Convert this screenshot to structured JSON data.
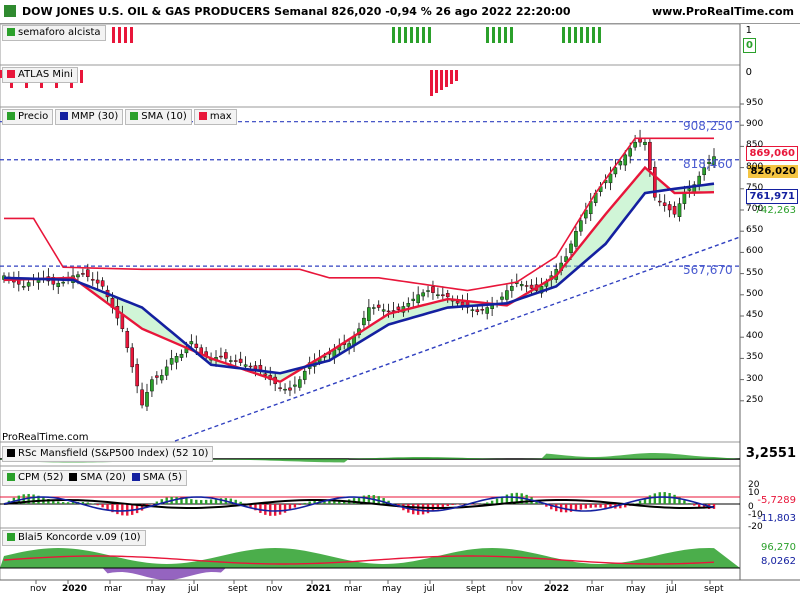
{
  "header": {
    "title": "DOW JONES U.S. OIL & GAS PRODUCERS Semanal 826,020 -0,94 % 26 ago 2022 22:20:00",
    "site": "www.ProRealTime.com"
  },
  "watermark": "ProRealTime.com",
  "panels": {
    "semaforo": {
      "label": "semaforo alcista",
      "value_top": "1",
      "value_box": "0"
    },
    "atlas": {
      "label": "ATLAS Mini",
      "value": "0"
    },
    "main": {
      "legend": [
        "Precio",
        "MMP (30)",
        "SMA (10)",
        "max"
      ],
      "right_labels": {
        "max": "869,060",
        "price": "826,020",
        "mmp": "761,971",
        "sma": "742,263"
      },
      "hline_labels": [
        "908,250",
        "818,460",
        "567,670"
      ],
      "y_ticks": [
        "950",
        "900",
        "850",
        "800",
        "750",
        "700",
        "650",
        "600",
        "550",
        "500",
        "450",
        "400",
        "350",
        "300",
        "250"
      ]
    },
    "rsc": {
      "label": "RSc Mansfield (S&P500 Index) (52 10)",
      "value": "3,2551"
    },
    "cpm": {
      "label_cpm": "CPM (52)",
      "label_sma20": "SMA (20)",
      "label_sma5": "SMA (5)",
      "ticks": [
        "20",
        "10",
        "0",
        "-10",
        "-20"
      ],
      "v1": "-5,7289",
      "v2": "-11,803"
    },
    "blai5": {
      "label": "Blai5 Koncorde v.09 (10)",
      "v1": "96,270",
      "v2": "8,0262"
    }
  },
  "x_axis": [
    "nov",
    "2020",
    "mar",
    "may",
    "jul",
    "sept",
    "nov",
    "2021",
    "mar",
    "may",
    "jul",
    "sept",
    "nov",
    "2022",
    "mar",
    "may",
    "jul",
    "sept"
  ],
  "colors": {
    "green": "#2ba02b",
    "red": "#e8163a",
    "blue": "#1420a0",
    "dash": "#3040c0",
    "cloud": "#96e8a6",
    "pink": "#f3b6c4"
  },
  "chart_data": {
    "type": "candlestick",
    "title": "DOW JONES U.S. OIL & GAS PRODUCERS Semanal 826,020 -0,94 % 26 ago 2022 22:20:00",
    "xlabel": "",
    "ylabel": "",
    "x_range": [
      "2019-10",
      "2022-09"
    ],
    "ylim": [
      200,
      950
    ],
    "last_close": 826.02,
    "change_pct": -0.94,
    "horizontal_levels": [
      908.25,
      818.46,
      567.67
    ],
    "series": [
      {
        "name": "Precio",
        "points": [
          [
            0,
            545
          ],
          [
            2,
            530
          ],
          [
            4,
            520
          ],
          [
            6,
            538
          ],
          [
            8,
            540
          ],
          [
            10,
            525
          ],
          [
            12,
            530
          ],
          [
            14,
            545
          ],
          [
            16,
            550
          ],
          [
            18,
            535
          ],
          [
            20,
            520
          ],
          [
            22,
            470
          ],
          [
            24,
            420
          ],
          [
            26,
            330
          ],
          [
            28,
            240
          ],
          [
            30,
            300
          ],
          [
            32,
            310
          ],
          [
            34,
            350
          ],
          [
            36,
            360
          ],
          [
            38,
            390
          ],
          [
            40,
            360
          ],
          [
            42,
            350
          ],
          [
            44,
            355
          ],
          [
            46,
            345
          ],
          [
            48,
            340
          ],
          [
            50,
            330
          ],
          [
            52,
            320
          ],
          [
            54,
            300
          ],
          [
            56,
            280
          ],
          [
            58,
            275
          ],
          [
            60,
            300
          ],
          [
            62,
            340
          ],
          [
            64,
            350
          ],
          [
            66,
            360
          ],
          [
            68,
            380
          ],
          [
            70,
            385
          ],
          [
            72,
            420
          ],
          [
            74,
            470
          ],
          [
            76,
            470
          ],
          [
            78,
            460
          ],
          [
            80,
            465
          ],
          [
            82,
            480
          ],
          [
            84,
            500
          ],
          [
            86,
            510
          ],
          [
            88,
            500
          ],
          [
            90,
            495
          ],
          [
            92,
            480
          ],
          [
            94,
            470
          ],
          [
            96,
            460
          ],
          [
            98,
            470
          ],
          [
            100,
            480
          ],
          [
            102,
            510
          ],
          [
            104,
            530
          ],
          [
            106,
            520
          ],
          [
            108,
            510
          ],
          [
            110,
            530
          ],
          [
            112,
            560
          ],
          [
            114,
            590
          ],
          [
            116,
            650
          ],
          [
            118,
            700
          ],
          [
            120,
            740
          ],
          [
            122,
            770
          ],
          [
            124,
            800
          ],
          [
            126,
            830
          ],
          [
            128,
            860
          ],
          [
            130,
            860
          ],
          [
            132,
            730
          ],
          [
            134,
            710
          ],
          [
            136,
            690
          ],
          [
            138,
            740
          ],
          [
            140,
            760
          ],
          [
            142,
            800
          ],
          [
            144,
            826
          ]
        ]
      },
      {
        "name": "MMP (30)",
        "points": [
          [
            0,
            540
          ],
          [
            14,
            535
          ],
          [
            28,
            470
          ],
          [
            42,
            335
          ],
          [
            56,
            315
          ],
          [
            66,
            345
          ],
          [
            78,
            430
          ],
          [
            90,
            470
          ],
          [
            102,
            480
          ],
          [
            112,
            520
          ],
          [
            122,
            620
          ],
          [
            130,
            740
          ],
          [
            136,
            750
          ],
          [
            144,
            762
          ]
        ]
      },
      {
        "name": "SMA (10)",
        "points": [
          [
            0,
            535
          ],
          [
            14,
            540
          ],
          [
            28,
            420
          ],
          [
            42,
            350
          ],
          [
            56,
            295
          ],
          [
            66,
            365
          ],
          [
            78,
            455
          ],
          [
            90,
            490
          ],
          [
            102,
            475
          ],
          [
            112,
            545
          ],
          [
            122,
            690
          ],
          [
            130,
            800
          ],
          [
            136,
            740
          ],
          [
            144,
            742
          ]
        ]
      },
      {
        "name": "max",
        "points": [
          [
            0,
            680
          ],
          [
            6,
            680
          ],
          [
            12,
            565
          ],
          [
            28,
            560
          ],
          [
            48,
            560
          ],
          [
            60,
            560
          ],
          [
            66,
            540
          ],
          [
            76,
            540
          ],
          [
            94,
            510
          ],
          [
            104,
            530
          ],
          [
            112,
            590
          ],
          [
            120,
            740
          ],
          [
            128,
            869
          ],
          [
            144,
            869
          ]
        ]
      }
    ]
  }
}
